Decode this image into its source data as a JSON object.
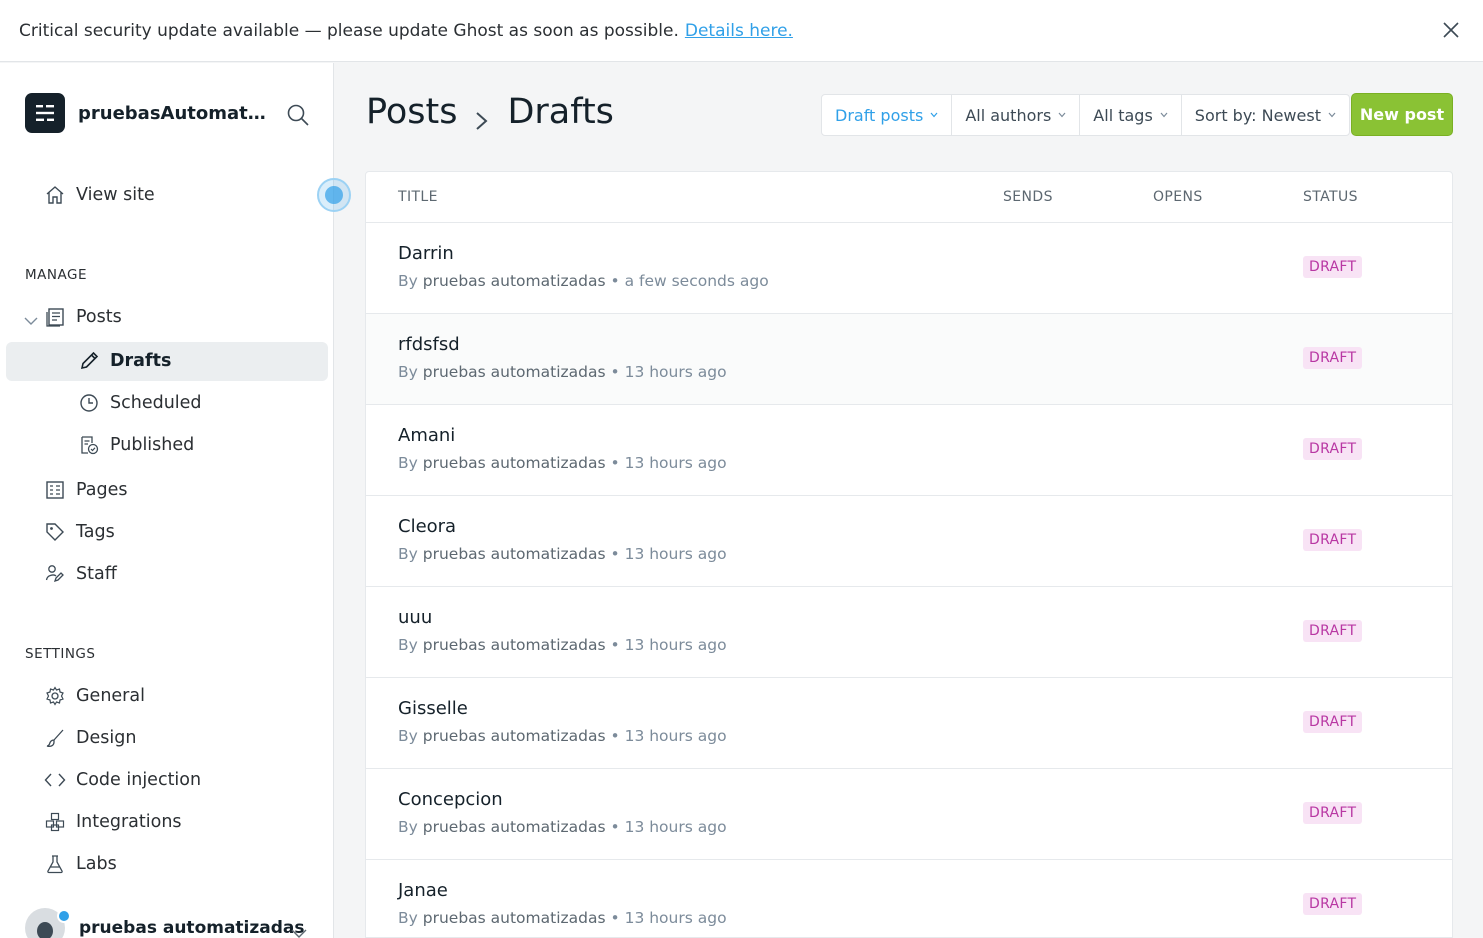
{
  "banner": {
    "text": "Critical security update available — please update Ghost as soon as possible.",
    "link": "Details here."
  },
  "sidebar": {
    "site_name": "pruebasAutomatiz...",
    "view_site": "View site",
    "manage_label": "MANAGE",
    "posts": "Posts",
    "drafts": "Drafts",
    "scheduled": "Scheduled",
    "published": "Published",
    "pages": "Pages",
    "tags": "Tags",
    "staff": "Staff",
    "settings_label": "SETTINGS",
    "general": "General",
    "design": "Design",
    "code_injection": "Code injection",
    "integrations": "Integrations",
    "labs": "Labs",
    "user_name": "pruebas automatizadas"
  },
  "header": {
    "crumb_parent": "Posts",
    "crumb_current": "Drafts",
    "filters": {
      "type": "Draft posts",
      "authors": "All authors",
      "tags": "All tags",
      "sort": "Sort by: Newest"
    },
    "new_post": "New post"
  },
  "table": {
    "columns": {
      "title": "TITLE",
      "sends": "SENDS",
      "opens": "OPENS",
      "status": "STATUS"
    },
    "rows": [
      {
        "title": "Darrin",
        "by": "By",
        "author": "pruebas automatizadas",
        "time": "• a few seconds ago",
        "status": "DRAFT"
      },
      {
        "title": "rfdsfsd",
        "by": "By",
        "author": "pruebas automatizadas",
        "time": "• 13 hours ago",
        "status": "DRAFT"
      },
      {
        "title": "Amani",
        "by": "By",
        "author": "pruebas automatizadas",
        "time": "• 13 hours ago",
        "status": "DRAFT"
      },
      {
        "title": "Cleora",
        "by": "By",
        "author": "pruebas automatizadas",
        "time": "• 13 hours ago",
        "status": "DRAFT"
      },
      {
        "title": "uuu",
        "by": "By",
        "author": "pruebas automatizadas",
        "time": "• 13 hours ago",
        "status": "DRAFT"
      },
      {
        "title": "Gisselle",
        "by": "By",
        "author": "pruebas automatizadas",
        "time": "• 13 hours ago",
        "status": "DRAFT"
      },
      {
        "title": "Concepcion",
        "by": "By",
        "author": "pruebas automatizadas",
        "time": "• 13 hours ago",
        "status": "DRAFT"
      },
      {
        "title": "Janae",
        "by": "By",
        "author": "pruebas automatizadas",
        "time": "• 13 hours ago",
        "status": "DRAFT"
      }
    ]
  },
  "colors": {
    "accent": "#30a0e8",
    "new_post_bg": "#8ac234",
    "draft_badge_bg": "#f8e3f5",
    "draft_badge_text": "#b837a3"
  },
  "icons": [
    "close-icon",
    "brand-logo-icon",
    "search-icon",
    "home-icon",
    "chevron-down-icon",
    "posts-icon",
    "pencil-icon",
    "clock-icon",
    "published-icon",
    "pages-icon",
    "tag-icon",
    "staff-icon",
    "gear-icon",
    "brush-icon",
    "code-icon",
    "integrations-icon",
    "flask-icon",
    "chevron-right-icon"
  ]
}
